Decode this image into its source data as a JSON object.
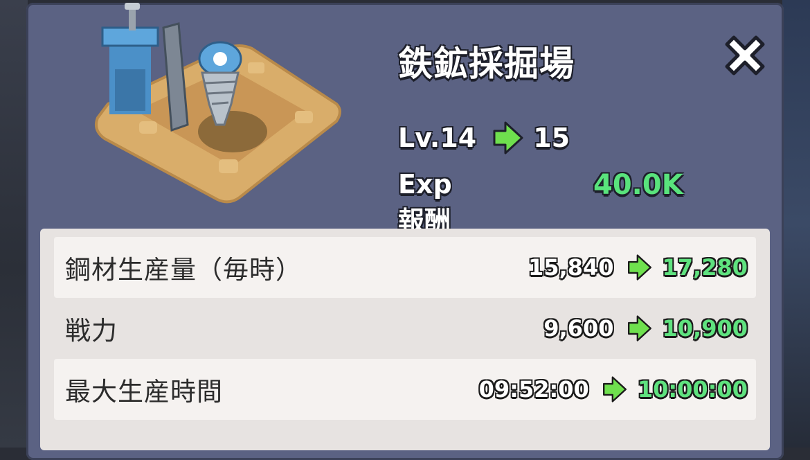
{
  "building": {
    "name": "鉄鉱採掘場",
    "icon": "iron-mine-drill-building"
  },
  "level": {
    "current": "Lv.14",
    "next": "15"
  },
  "exp_reward": {
    "label": "Exp報酬",
    "value": "40.0K"
  },
  "stats": [
    {
      "label": "鋼材生産量（毎時）",
      "current": "15,840",
      "next": "17,280"
    },
    {
      "label": "戦力",
      "current": "9,600",
      "next": "10,900"
    },
    {
      "label": "最大生産時間",
      "current": "09:52:00",
      "next": "10:00:00"
    }
  ],
  "icons": {
    "close": "close-icon",
    "arrow": "green-right-arrow-icon"
  },
  "colors": {
    "panel": "#5b6283",
    "increase_green": "#5fe27f",
    "stats_bg": "#e7e3e1"
  }
}
